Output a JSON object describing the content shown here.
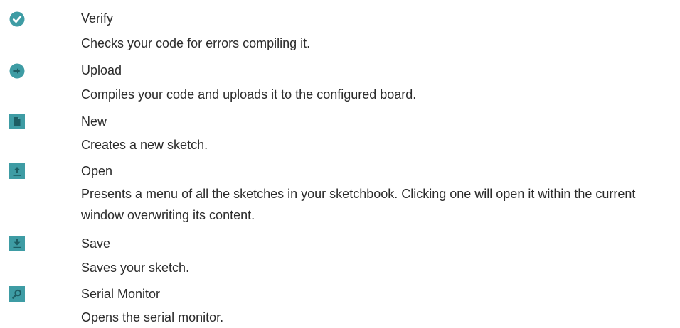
{
  "colors": {
    "icon_teal": "#3e9ca4",
    "icon_dark": "#1d5d63",
    "text": "#2b2b2b"
  },
  "items": [
    {
      "id": "verify",
      "icon": "checkmark-circle-icon",
      "title": "Verify",
      "description": "Checks your code for errors compiling it."
    },
    {
      "id": "upload",
      "icon": "arrow-right-circle-icon",
      "title": "Upload",
      "description": "Compiles your code and uploads it to the configured board."
    },
    {
      "id": "new",
      "icon": "new-file-icon",
      "title": "New",
      "description": "Creates a new sketch."
    },
    {
      "id": "open",
      "icon": "open-arrow-up-icon",
      "title": "Open",
      "description": "Presents a menu of all the sketches in your sketchbook. Clicking one will open it within the current window overwriting its content."
    },
    {
      "id": "save",
      "icon": "save-arrow-down-icon",
      "title": "Save",
      "description": "Saves your sketch."
    },
    {
      "id": "serial-monitor",
      "icon": "serial-monitor-magnifier-icon",
      "title": "Serial Monitor",
      "description": "Opens the serial monitor."
    }
  ]
}
